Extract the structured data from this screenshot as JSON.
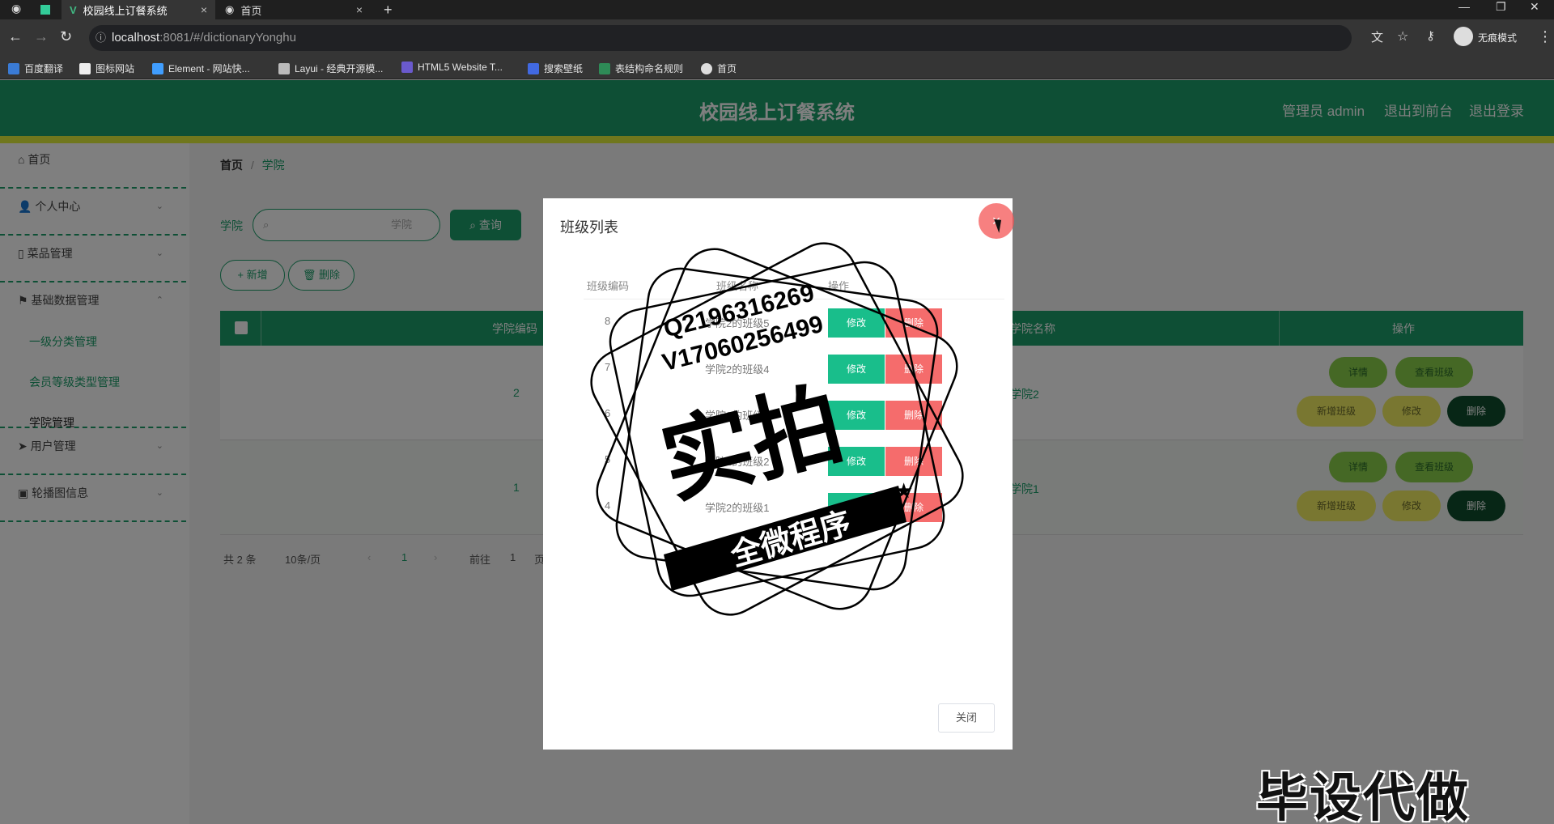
{
  "browser": {
    "tabs": [
      {
        "label": "校园线上订餐系统",
        "active": true
      },
      {
        "label": "首页",
        "active": false
      }
    ],
    "url_host": "localhost",
    "url_rest": ":8081/#/dictionaryYonghu",
    "incognito_label": "无痕模式",
    "bookmarks": [
      "百度翻译",
      "图标网站",
      "Element - 网站快...",
      "Layui - 经典开源模...",
      "HTML5 Website T...",
      "搜索壁纸",
      "表结构命名规则",
      "首页"
    ]
  },
  "header": {
    "title": "校园线上订餐系统",
    "user": "管理员 admin",
    "front_link": "退出到前台",
    "logout": "退出登录"
  },
  "sidebar": {
    "items": [
      {
        "label": "首页"
      },
      {
        "label": "个人中心"
      },
      {
        "label": "菜品管理"
      },
      {
        "label": "基础数据管理"
      },
      {
        "label": "用户管理"
      },
      {
        "label": "轮播图信息"
      }
    ],
    "sub_items": [
      "一级分类管理",
      "会员等级类型管理",
      "学院管理"
    ]
  },
  "main": {
    "breadcrumb_home": "首页",
    "breadcrumb_sep": "/",
    "breadcrumb_current": "学院",
    "search_label": "学院",
    "search_placeholder": "学院",
    "query_button": "查询",
    "add_button": "+ 新增",
    "delete_button": "删除",
    "columns": [
      "学院编码",
      "学院名称",
      "操作"
    ],
    "rows": [
      {
        "code": "2",
        "name": "学院2"
      },
      {
        "code": "1",
        "name": "学院1"
      }
    ],
    "row_actions": [
      "详情",
      "查看班级",
      "新增班级",
      "修改",
      "删除"
    ],
    "pager": {
      "total": "共 2 条",
      "size": "10条/页",
      "page": "1",
      "goto": "前往",
      "goto_page": "1",
      "page_unit": "页"
    }
  },
  "dialog": {
    "title": "班级列表",
    "columns": [
      "班级编码",
      "班级名称",
      "操作"
    ],
    "rows": [
      {
        "code": "8",
        "name": "学院2的班级5"
      },
      {
        "code": "7",
        "name": "学院2的班级4"
      },
      {
        "code": "6",
        "name": "学院2的班级3"
      },
      {
        "code": "5",
        "name": "学院2的班级2"
      },
      {
        "code": "4",
        "name": "学院2的班级1"
      }
    ],
    "edit_label": "修改",
    "delete_label": "删除",
    "close_button": "关闭",
    "close_icon": "×"
  },
  "watermark": {
    "line1": "Q2196316269",
    "line2": "V17060256499",
    "big": "实拍",
    "banner": "全微程序",
    "corner": "毕设代做"
  }
}
